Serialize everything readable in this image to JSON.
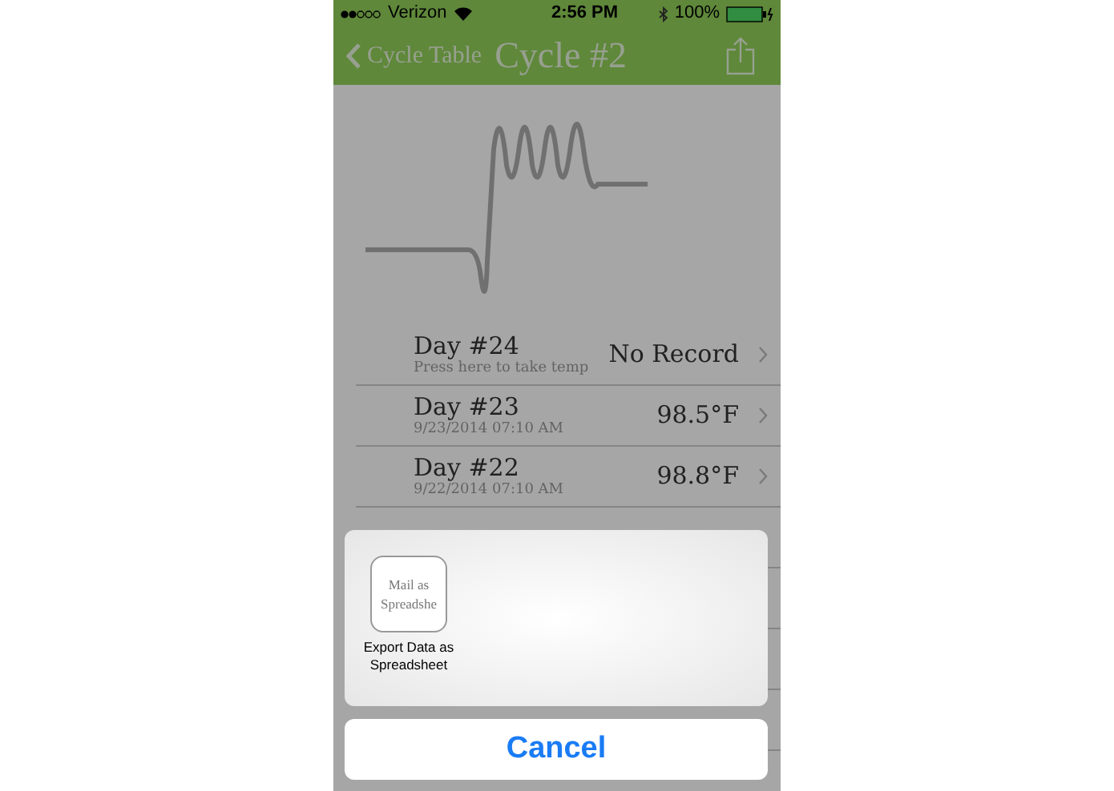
{
  "status_bar": {
    "carrier": "Verizon",
    "time": "2:56 PM",
    "battery": "100%"
  },
  "nav": {
    "back": "Cycle Table",
    "title": "Cycle #2"
  },
  "days": [
    {
      "title": "Day #24",
      "subtitle": "Press here to take temp",
      "value": "No Record"
    },
    {
      "title": "Day #23",
      "subtitle": "9/23/2014 07:10 AM",
      "value": "98.5°F"
    },
    {
      "title": "Day #22",
      "subtitle": "9/22/2014 07:10 AM",
      "value": "98.8°F"
    }
  ],
  "action_sheet": {
    "actions": [
      {
        "tile": "Mail as Spreadshe",
        "label": "Export Data as Spreadsheet"
      }
    ],
    "cancel": "Cancel"
  }
}
